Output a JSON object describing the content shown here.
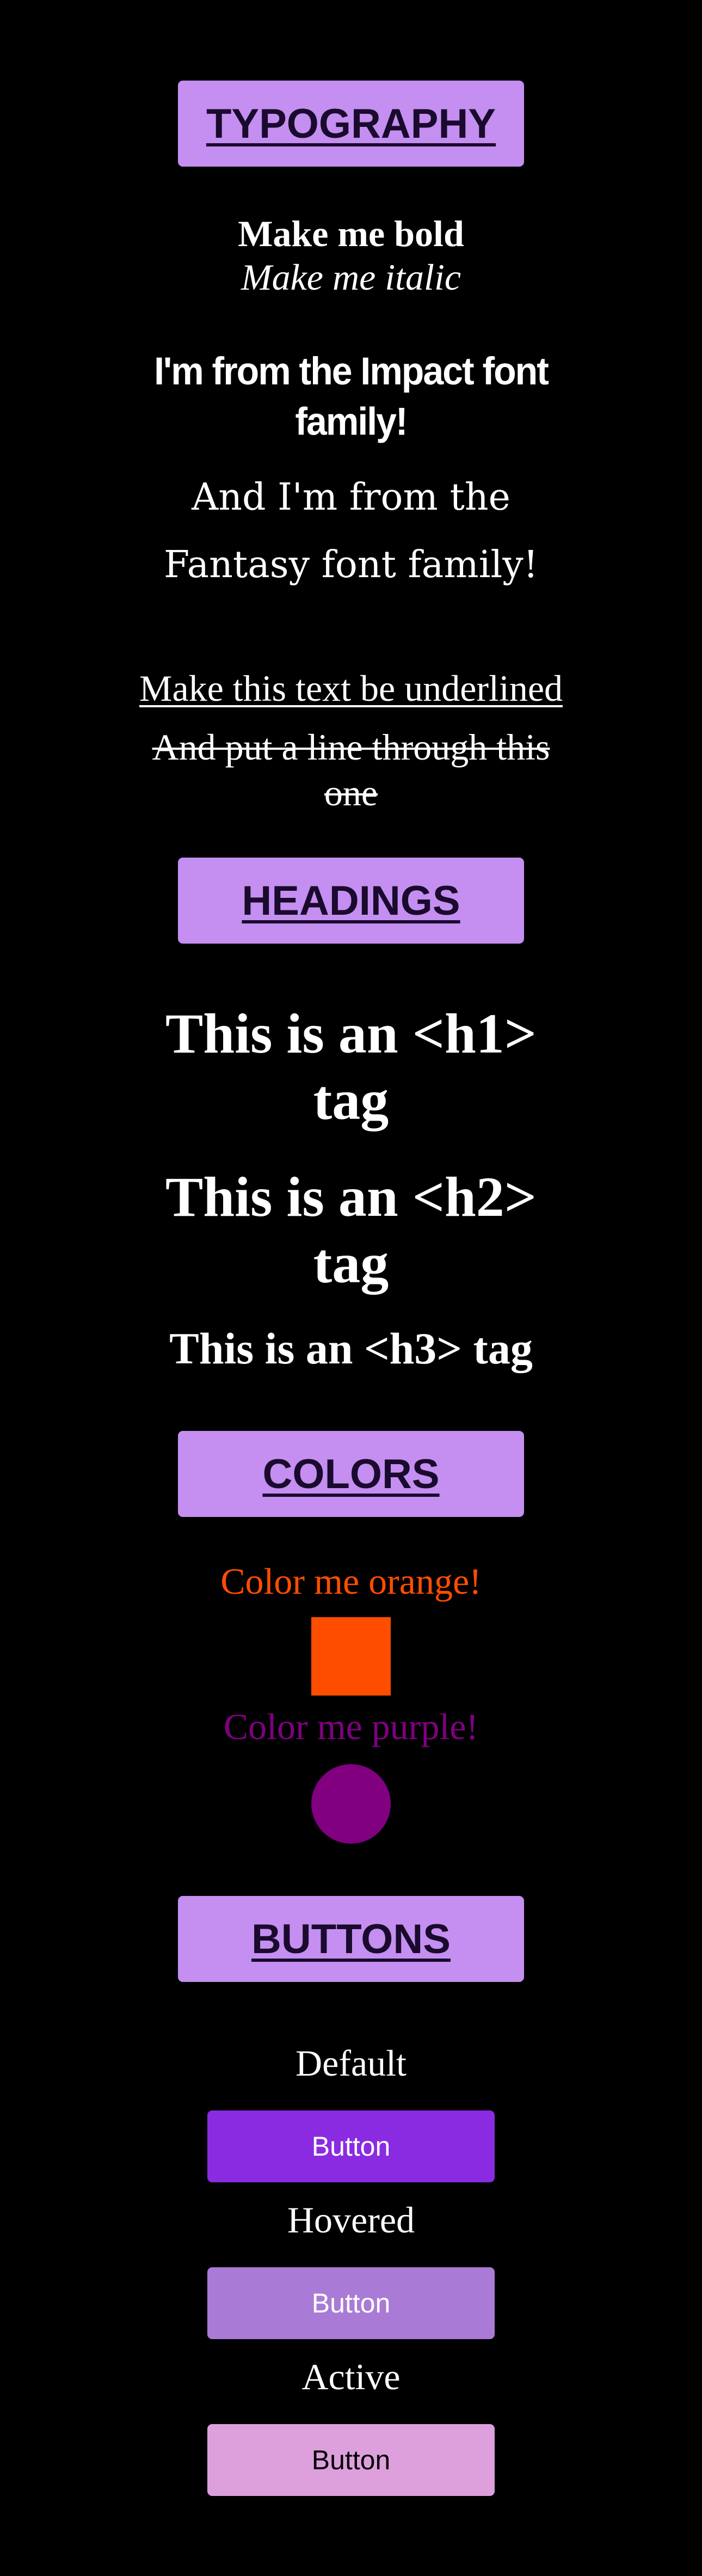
{
  "typography": {
    "heading": "TYPOGRAPHY",
    "bold": "Make me bold",
    "italic": "Make me italic",
    "impact": "I'm from the Impact font family!",
    "fantasy": "And I'm from the Fantasy font family!",
    "underline": "Make this text be underlined",
    "strike": "And put a line through this one"
  },
  "headings": {
    "heading": "HEADINGS",
    "h1": "This is an <h1> tag",
    "h2": "This is an <h2> tag",
    "h3": "This is an <h3> tag"
  },
  "colors": {
    "heading": "COLORS",
    "orange_text": "Color me orange!",
    "orange": "#ff4d00",
    "purple_text": "Color me purple!",
    "purple": "#800080"
  },
  "buttons": {
    "heading": "BUTTONS",
    "default_label": "Default",
    "default_button": "Button",
    "default_bg": "#8a2be2",
    "hovered_label": "Hovered",
    "hovered_button": "Button",
    "hovered_bg": "#a97bd6",
    "active_label": "Active",
    "active_button": "Button",
    "active_bg": "#dda0dd"
  }
}
